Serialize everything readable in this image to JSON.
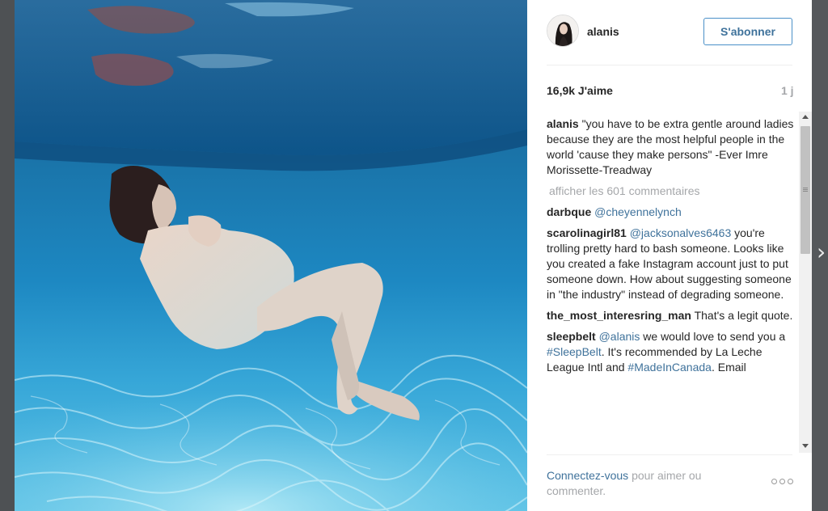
{
  "post": {
    "username": "alanis",
    "follow_label": "S'abonner",
    "likes": "16,9k J'aime",
    "time_ago": "1 j",
    "caption_user": "alanis",
    "caption_text": "\"you have to be extra gentle around ladies because they are the most helpful people in the world 'cause they make persons\" -Ever Imre Morissette-Treadway",
    "view_all_comments": "afficher les 601 commentaires"
  },
  "comments": [
    {
      "user": "darbque",
      "mention": "@cheyennelynch",
      "text": ""
    },
    {
      "user": "scarolinagirl81",
      "mention": "@jacksonalves6463",
      "text": "you're trolling pretty hard to bash someone. Looks like you created a fake Instagram account just to put someone down. How about suggesting someone in \"the industry\" instead of degrading someone."
    },
    {
      "user": "the_most_interesring_man",
      "mention": "",
      "text": "That's a legit quote."
    },
    {
      "user": "sleepbelt",
      "mention": "@alanis",
      "text_1": "we would love to send you a",
      "tag_1": "#SleepBelt",
      "text_2": ". It's recommended by La Leche League Intl and",
      "tag_2": "#MadeInCanada",
      "text_3": ". Email"
    }
  ],
  "footer": {
    "login_link": "Connectez-vous",
    "login_text": "pour aimer ou commenter."
  },
  "icons": {
    "options": "ellipsis-icon",
    "next": "chevron-right-icon",
    "scroll_up": "arrow-up-icon",
    "scroll_down": "arrow-down-icon"
  },
  "colors": {
    "link": "#3f729b",
    "follow_border": "#4a90c8",
    "muted": "#a5a7aa",
    "text": "#262626"
  }
}
